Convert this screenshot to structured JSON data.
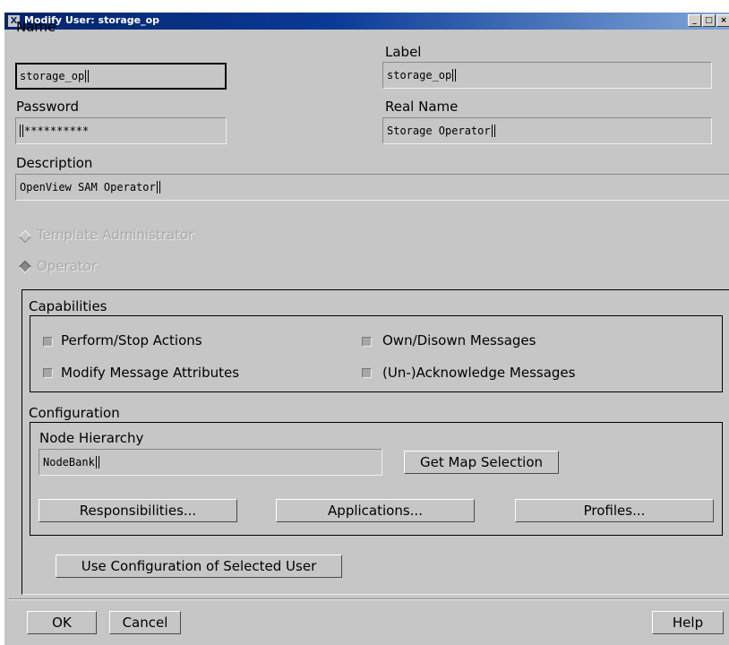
{
  "window": {
    "title": "Modify User: storage_op",
    "app_icon": "X",
    "controls": [
      "_",
      "□",
      "×"
    ]
  },
  "fields": {
    "name_label": "Name",
    "name_value": "storage_op",
    "label_label": "Label",
    "label_value": "storage_op",
    "password_label": "Password",
    "password_value": "**********",
    "realname_label": "Real Name",
    "realname_value": "Storage Operator",
    "description_label": "Description",
    "description_value": "OpenView SAM Operator"
  },
  "roles": {
    "template_admin": "Template Administrator",
    "operator": "Operator",
    "selected": "operator"
  },
  "capabilities": {
    "title": "Capabilities",
    "items": [
      "Perform/Stop Actions",
      "Own/Disown Messages",
      "Modify Message Attributes",
      "(Un-)Acknowledge Messages"
    ]
  },
  "configuration": {
    "title": "Configuration",
    "node_hierarchy_label": "Node Hierarchy",
    "node_hierarchy_value": "NodeBank",
    "get_map_selection": "Get Map Selection",
    "responsibilities": "Responsibilities...",
    "applications": "Applications...",
    "profiles": "Profiles...",
    "use_config": "Use Configuration of Selected User"
  },
  "footer": {
    "ok": "OK",
    "cancel": "Cancel",
    "help": "Help"
  }
}
